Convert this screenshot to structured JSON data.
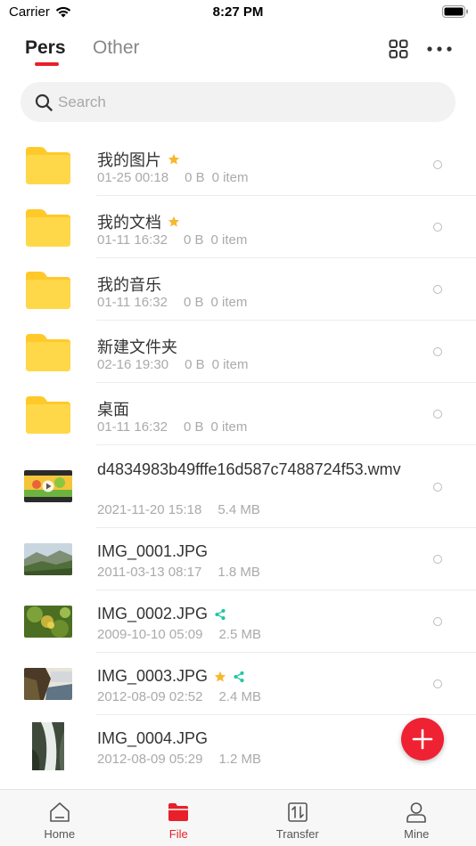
{
  "status_bar": {
    "carrier": "Carrier",
    "time": "8:27 PM"
  },
  "header": {
    "tabs": [
      {
        "label": "Pers",
        "active": true
      },
      {
        "label": "Other",
        "active": false
      }
    ],
    "grid_icon": "grid-view-icon",
    "more_icon": "more-icon"
  },
  "search": {
    "placeholder": "Search",
    "value": ""
  },
  "files": [
    {
      "name": "我的图片",
      "date": "01-25 00:18",
      "size": "0 B",
      "items": "0 item",
      "type": "folder",
      "starred": true,
      "shared": false
    },
    {
      "name": "我的文档",
      "date": "01-11 16:32",
      "size": "0 B",
      "items": "0 item",
      "type": "folder",
      "starred": true,
      "shared": false
    },
    {
      "name": "我的音乐",
      "date": "01-11 16:32",
      "size": "0 B",
      "items": "0 item",
      "type": "folder",
      "starred": false,
      "shared": false
    },
    {
      "name": "新建文件夹",
      "date": "02-16 19:30",
      "size": "0 B",
      "items": "0 item",
      "type": "folder",
      "starred": false,
      "shared": false
    },
    {
      "name": "桌面",
      "date": "01-11 16:32",
      "size": "0 B",
      "items": "0 item",
      "type": "folder",
      "starred": false,
      "shared": false
    },
    {
      "name": "d4834983b49fffe16d587c7488724f53.wmv",
      "date": "2021-11-20 15:18",
      "size": "5.4 MB",
      "type": "video",
      "starred": false,
      "shared": false
    },
    {
      "name": "IMG_0001.JPG",
      "date": "2011-03-13 08:17",
      "size": "1.8 MB",
      "type": "image",
      "starred": false,
      "shared": false
    },
    {
      "name": "IMG_0002.JPG",
      "date": "2009-10-10 05:09",
      "size": "2.5 MB",
      "type": "image",
      "starred": false,
      "shared": true
    },
    {
      "name": "IMG_0003.JPG",
      "date": "2012-08-09 02:52",
      "size": "2.4 MB",
      "type": "image",
      "starred": true,
      "shared": true
    },
    {
      "name": "IMG_0004.JPG",
      "date": "2012-08-09 05:29",
      "size": "1.2 MB",
      "type": "image",
      "starred": false,
      "shared": false
    }
  ],
  "fab": {
    "icon": "plus-icon",
    "color": "#ee2233"
  },
  "tabbar": [
    {
      "label": "Home",
      "icon": "home-icon",
      "active": false
    },
    {
      "label": "File",
      "icon": "folder-icon",
      "active": true
    },
    {
      "label": "Transfer",
      "icon": "transfer-icon",
      "active": false
    },
    {
      "label": "Mine",
      "icon": "profile-icon",
      "active": false
    }
  ],
  "colors": {
    "accent": "#e8202a",
    "folder": "#ffcc33",
    "star": "#f5b82e",
    "share": "#1fc8a0"
  }
}
